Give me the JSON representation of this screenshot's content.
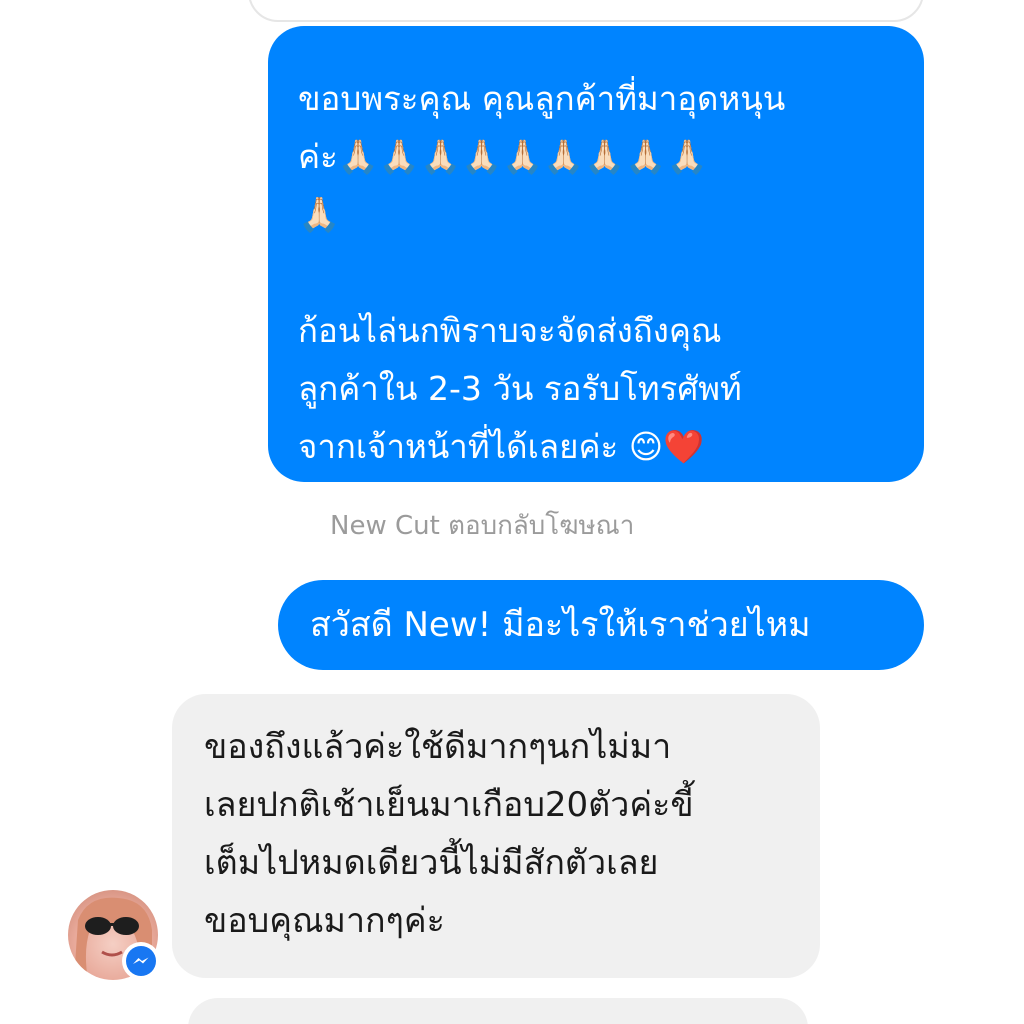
{
  "messages": {
    "outgoing_long": {
      "line1": "ขอบพระคุณ คุณลูกค้าที่มาอุดหนุน",
      "line2_text": "ค่ะ",
      "emojis_row1": "🙏🏻🙏🏻🙏🏻🙏🏻🙏🏻🙏🏻🙏🏻🙏🏻🙏🏻",
      "emojis_row2": "🙏🏻",
      "line4": "ก้อนไล่นกพิราบจะจัดส่งถึงคุณ",
      "line5": "ลูกค้าใน 2-3 วัน รอรับโทรศัพท์",
      "line6": "จากเจ้าหน้าที่ได้เลยค่ะ 😊❤️"
    },
    "caption": "New Cut ตอบกลับโฆษณา",
    "outgoing_short": "สวัสดี New! มีอะไรให้เราช่วยไหม",
    "incoming": {
      "line1": "ของถึงแล้วค่ะใช้ดีมากๆนกไม่มา",
      "line2": "เลยปกติเช้าเย็นมาเกือบ20ตัวค่ะขี้",
      "line3": "เต็มไปหมดเดียวนี้ไม่มีสักตัวเลย",
      "line4": "ขอบคุณมากๆค่ะ"
    }
  },
  "colors": {
    "outgoing_bubble": "#0084ff",
    "incoming_bubble": "#f0f0f0",
    "caption": "#9b9b9b",
    "messenger_badge": "#1877f2"
  },
  "icons": {
    "badge": "messenger-icon"
  }
}
